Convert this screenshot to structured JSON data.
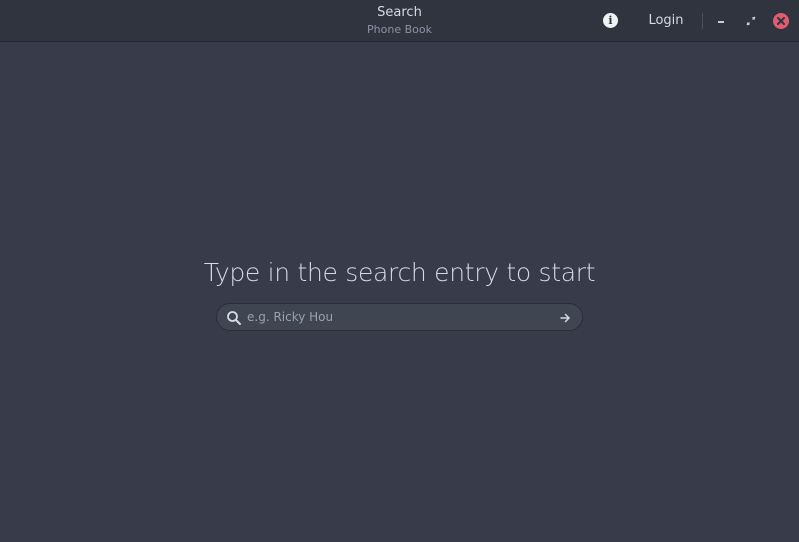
{
  "window": {
    "title": "Search",
    "subtitle": "Phone Book"
  },
  "header": {
    "info_icon": "info-icon",
    "login_label": "Login",
    "controls": {
      "minimize_icon": "minimize-icon",
      "maximize_icon": "maximize-icon",
      "close_icon": "close-icon"
    }
  },
  "main": {
    "empty_state_text": "Type in the search entry to start",
    "search": {
      "value": "",
      "placeholder": "e.g. Ricky Hou",
      "leading_icon": "search-icon",
      "trailing_icon": "arrow-right-icon"
    }
  },
  "colors": {
    "background": "#383c4a",
    "headerbar": "#2f343f",
    "text": "#d3dae3",
    "subtitle": "#8b93a3",
    "close_button": "#e05d6f",
    "entry_bg": "#404552"
  }
}
